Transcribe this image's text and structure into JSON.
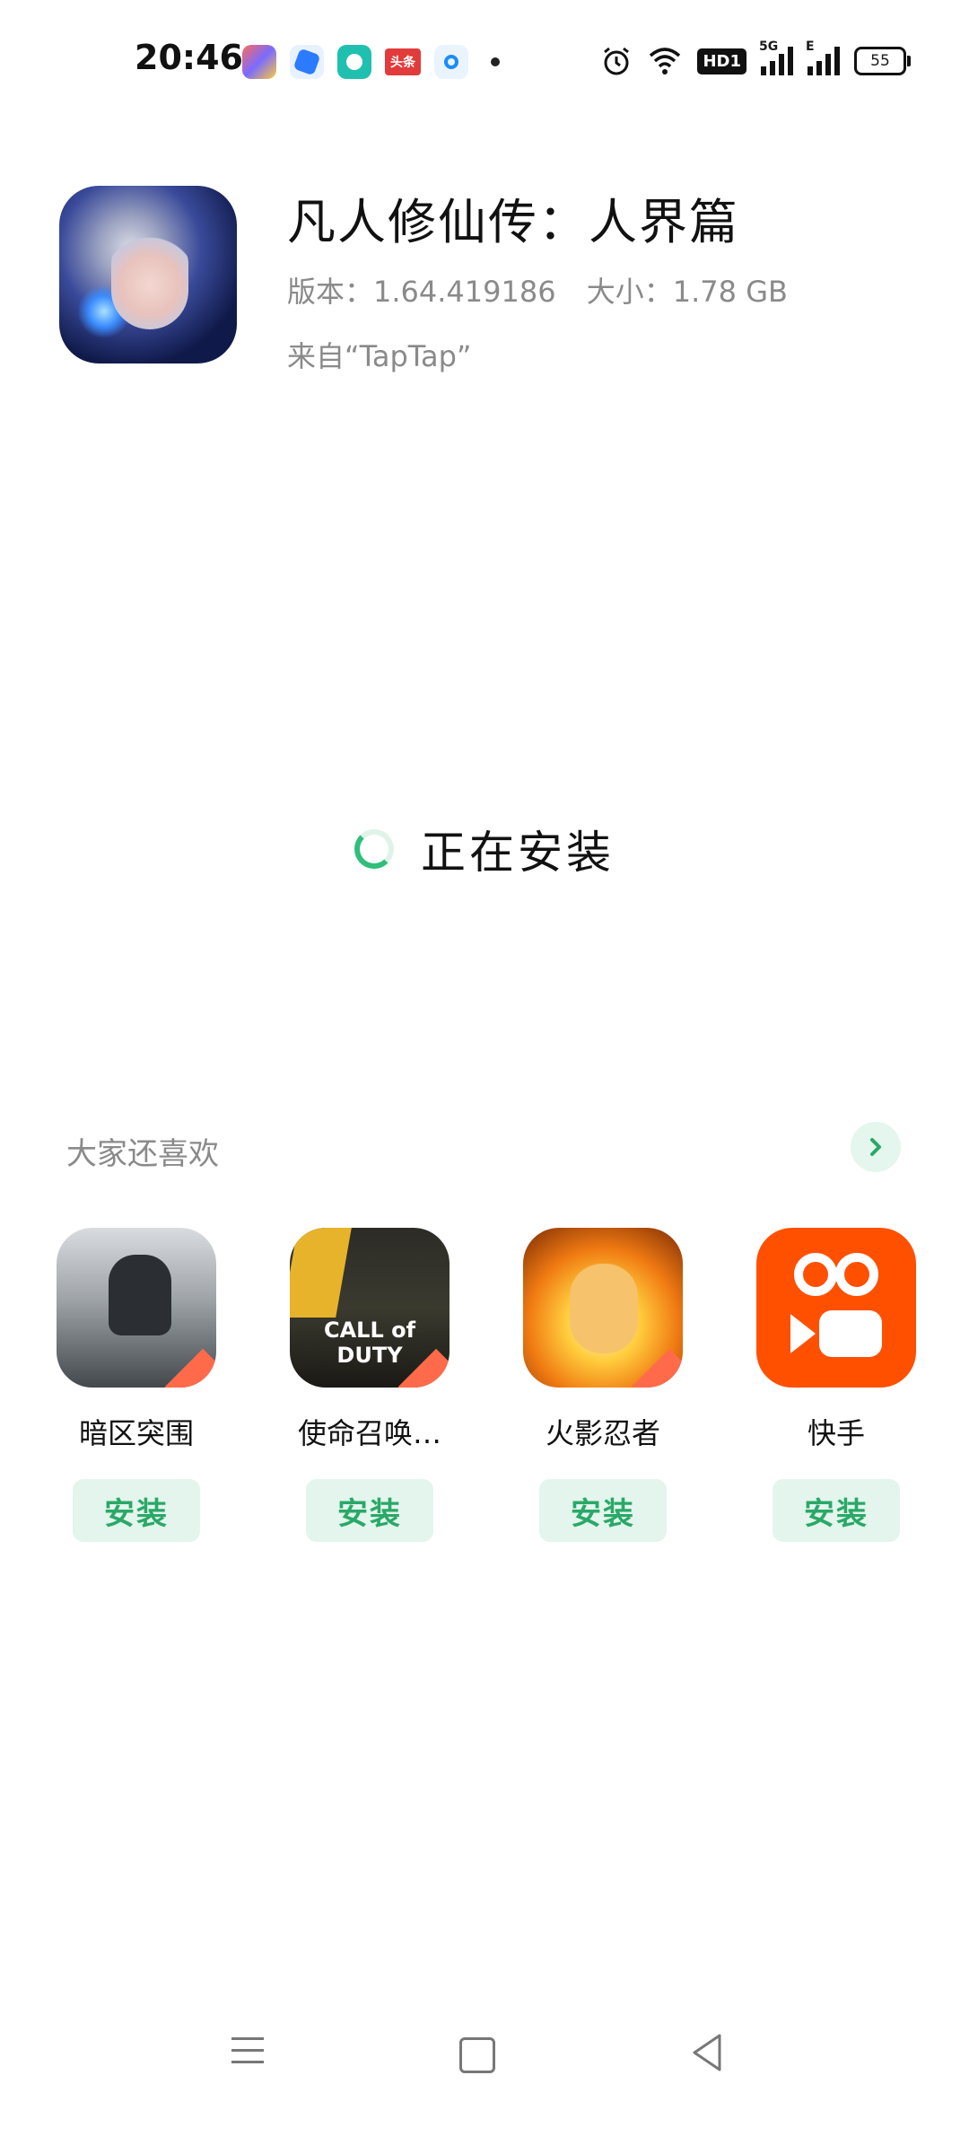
{
  "status_bar": {
    "time": "20:46",
    "notifications": [
      "headline-badge-label"
    ],
    "headline_badge": "头条",
    "hd_label": "HD1",
    "signal1_label": "5G",
    "signal2_label": "E",
    "battery": "55"
  },
  "app": {
    "title": "凡人修仙传：人界篇",
    "version": "版本：1.64.419186",
    "size": "大小：1.78 GB",
    "source": "来自“TapTap”"
  },
  "install": {
    "status": "正在安装"
  },
  "recommend": {
    "title": "大家还喜欢",
    "items": [
      {
        "name": "暗区突围",
        "button": "安装"
      },
      {
        "name": "使命召唤…",
        "button": "安装"
      },
      {
        "name": "火影忍者",
        "button": "安装"
      },
      {
        "name": "快手",
        "button": "安装"
      }
    ],
    "cod_logo": "CALL of DUTY"
  },
  "colors": {
    "accent": "#2fbf7a",
    "button_bg": "#e3f5ec",
    "button_text": "#2aa868"
  }
}
